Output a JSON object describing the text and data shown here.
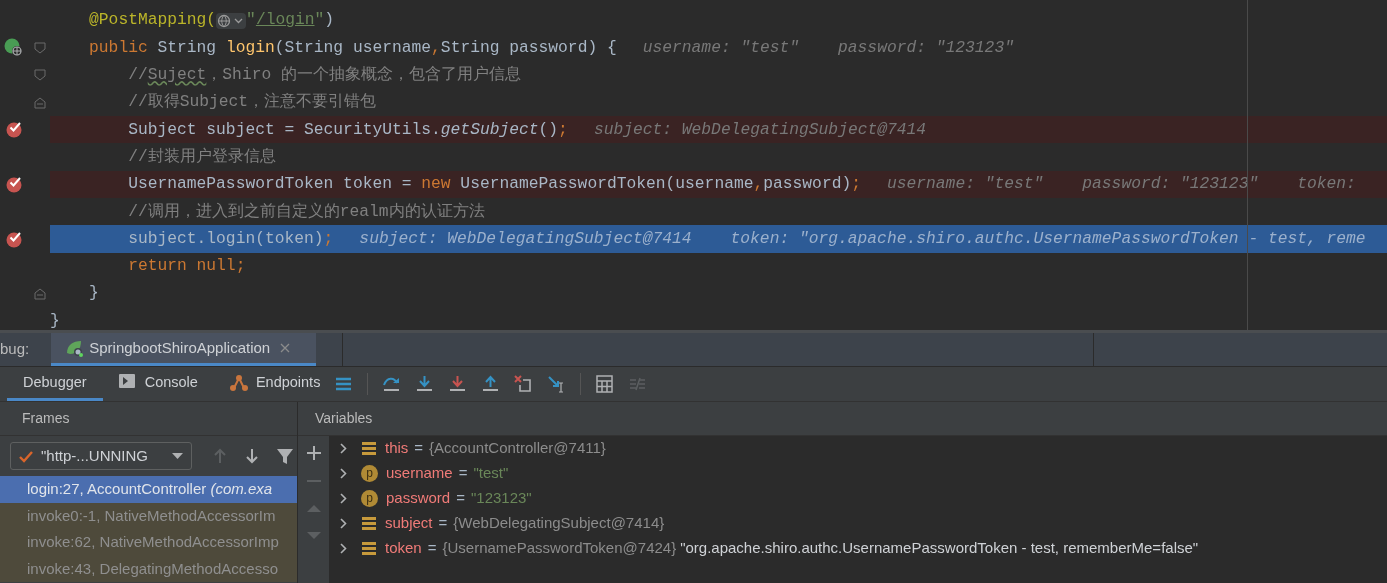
{
  "editor": {
    "lines": [
      {
        "breakpoint": false,
        "current": false,
        "run_marker": false,
        "fold_start": false,
        "fold_end": false,
        "segments": [
          {
            "kind": "code",
            "tokens": [
              {
                "kind": "annotation",
                "text": "    @PostMapping("
              }
            ]
          },
          {
            "kind": "icon"
          },
          {
            "kind": "code",
            "tokens": [
              {
                "kind": "string",
                "text": "\""
              },
              {
                "kind": "link",
                "text": "/login"
              },
              {
                "kind": "string",
                "text": "\""
              },
              {
                "kind": "plain",
                "text": ")"
              }
            ]
          }
        ]
      },
      {
        "breakpoint": false,
        "current": false,
        "run_marker": true,
        "fold_start": true,
        "fold_end": false,
        "segments": [
          {
            "kind": "code",
            "tokens": [
              {
                "kind": "keyword",
                "text": "    public"
              },
              {
                "kind": "plain",
                "text": " String "
              },
              {
                "kind": "method",
                "text": "login"
              },
              {
                "kind": "plain",
                "text": "(String username"
              },
              {
                "kind": "keyword",
                "text": ","
              },
              {
                "kind": "plain",
                "text": "String password) {"
              }
            ]
          }
        ],
        "hints": [
          "username: \"test\"",
          "password: \"123123\""
        ]
      },
      {
        "breakpoint": false,
        "current": false,
        "run_marker": false,
        "fold_start": true,
        "fold_end": false,
        "segments": [
          {
            "kind": "code",
            "tokens": [
              {
                "kind": "comment",
                "text": "        //"
              },
              {
                "kind": "typo",
                "text": "Suject"
              },
              {
                "kind": "comment",
                "text": "，Shiro 的一个抽象概念，包含了用户信息"
              }
            ]
          }
        ]
      },
      {
        "breakpoint": false,
        "current": false,
        "run_marker": false,
        "fold_start": false,
        "fold_end": true,
        "segments": [
          {
            "kind": "code",
            "tokens": [
              {
                "kind": "comment",
                "text": "        //取得Subject，注意不要引错包"
              }
            ]
          }
        ]
      },
      {
        "breakpoint": true,
        "current": false,
        "run_marker": false,
        "fold_start": false,
        "fold_end": false,
        "segments": [
          {
            "kind": "code",
            "tokens": [
              {
                "kind": "plain",
                "text": "        Subject subject = SecurityUtils."
              },
              {
                "kind": "static",
                "text": "getSubject"
              },
              {
                "kind": "plain",
                "text": "()"
              },
              {
                "kind": "keyword",
                "text": ";"
              }
            ]
          }
        ],
        "hints": [
          "subject: WebDelegatingSubject@7414"
        ]
      },
      {
        "breakpoint": false,
        "current": false,
        "run_marker": false,
        "fold_start": false,
        "fold_end": false,
        "segments": [
          {
            "kind": "code",
            "tokens": [
              {
                "kind": "comment",
                "text": "        //封装用户登录信息"
              }
            ]
          }
        ]
      },
      {
        "breakpoint": true,
        "current": false,
        "run_marker": false,
        "fold_start": false,
        "fold_end": false,
        "segments": [
          {
            "kind": "code",
            "tokens": [
              {
                "kind": "plain",
                "text": "        UsernamePasswordToken token = "
              },
              {
                "kind": "keyword",
                "text": "new"
              },
              {
                "kind": "plain",
                "text": " UsernamePasswordToken(username"
              },
              {
                "kind": "keyword",
                "text": ","
              },
              {
                "kind": "plain",
                "text": "password)"
              },
              {
                "kind": "keyword",
                "text": ";"
              }
            ]
          }
        ],
        "hints": [
          "username: \"test\"",
          "password: \"123123\"",
          "token:"
        ]
      },
      {
        "breakpoint": false,
        "current": false,
        "run_marker": false,
        "fold_start": false,
        "fold_end": false,
        "segments": [
          {
            "kind": "code",
            "tokens": [
              {
                "kind": "comment",
                "text": "        //调用，进入到之前自定义的realm内的认证方法"
              }
            ]
          }
        ]
      },
      {
        "breakpoint": true,
        "current": true,
        "run_marker": false,
        "fold_start": false,
        "fold_end": false,
        "segments": [
          {
            "kind": "code",
            "tokens": [
              {
                "kind": "plain",
                "text": "        subject.login(token)"
              },
              {
                "kind": "keyword",
                "text": ";"
              }
            ]
          }
        ],
        "hints": [
          "subject: WebDelegatingSubject@7414",
          "token: \"org.apache.shiro.authc.UsernamePasswordToken - test, reme"
        ]
      },
      {
        "breakpoint": false,
        "current": false,
        "run_marker": false,
        "fold_start": false,
        "fold_end": false,
        "segments": [
          {
            "kind": "code",
            "tokens": [
              {
                "kind": "keyword",
                "text": "        return null;"
              }
            ]
          }
        ]
      },
      {
        "breakpoint": false,
        "current": false,
        "run_marker": false,
        "fold_start": false,
        "fold_end": true,
        "segments": [
          {
            "kind": "code",
            "tokens": [
              {
                "kind": "plain",
                "text": "    }"
              }
            ]
          }
        ]
      },
      {
        "breakpoint": false,
        "current": false,
        "run_marker": false,
        "fold_start": false,
        "fold_end": false,
        "segments": [
          {
            "kind": "code",
            "tokens": [
              {
                "kind": "plain",
                "text": "}"
              }
            ]
          }
        ]
      }
    ]
  },
  "debug": {
    "label": "bug:",
    "session_tabs": [
      {
        "label": "SpringbootShiroApplication",
        "selected": true
      }
    ],
    "tool_tabs": [
      {
        "label": "Debugger",
        "selected": true,
        "kind": "plain"
      },
      {
        "label": "Console",
        "selected": false,
        "kind": "console"
      },
      {
        "label": "Endpoints",
        "selected": false,
        "kind": "endpoints"
      }
    ],
    "frames": {
      "title": "Frames",
      "thread": "\"http-...UNNING",
      "items": [
        {
          "text": "login:27, AccountController ",
          "package": "(com.exa",
          "selected": true
        },
        {
          "text": "invoke0:-1, NativeMethodAccessorIm",
          "selected": false
        },
        {
          "text": "invoke:62, NativeMethodAccessorImp",
          "selected": false
        },
        {
          "text": "invoke:43, DelegatingMethodAccesso",
          "selected": false
        }
      ]
    },
    "variables": {
      "title": "Variables",
      "items": [
        {
          "kind": "field",
          "name": "this",
          "operator": "=",
          "value": "{AccountController@7411}",
          "string": false
        },
        {
          "kind": "param",
          "badge": "p",
          "name": "username",
          "operator": "=",
          "value": "\"test\"",
          "string": true
        },
        {
          "kind": "param",
          "badge": "p",
          "name": "password",
          "operator": "=",
          "value": "\"123123\"",
          "string": true
        },
        {
          "kind": "field",
          "name": "subject",
          "operator": "=",
          "value": "{WebDelegatingSubject@7414}",
          "string": false
        },
        {
          "kind": "field",
          "name": "token",
          "operator": "=",
          "value": "{UsernamePasswordToken@7424}",
          "string": false,
          "description": "\"org.apache.shiro.authc.UsernamePasswordToken - test, rememberMe=false\""
        }
      ]
    }
  }
}
